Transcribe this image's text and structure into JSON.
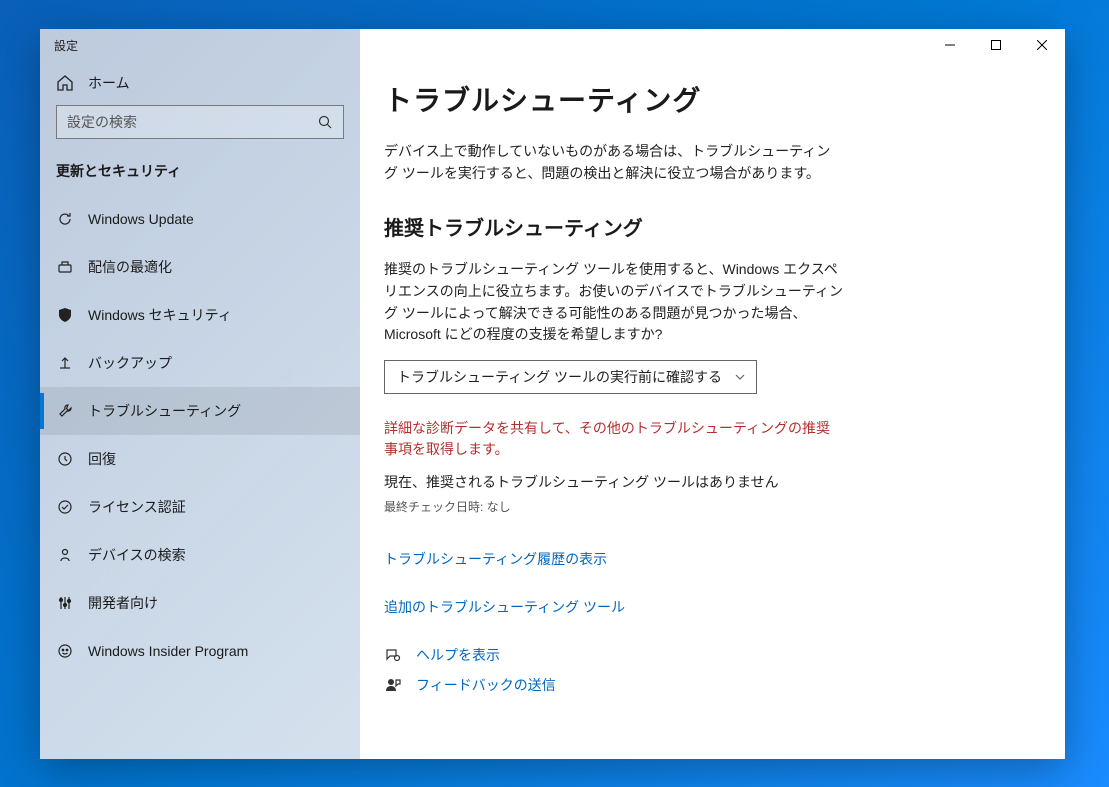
{
  "titlebar": {
    "title": "設定"
  },
  "sidebar": {
    "home_label": "ホーム",
    "search_placeholder": "設定の検索",
    "section_label": "更新とセキュリティ",
    "items": [
      {
        "label": "Windows Update"
      },
      {
        "label": "配信の最適化"
      },
      {
        "label": "Windows セキュリティ"
      },
      {
        "label": "バックアップ"
      },
      {
        "label": "トラブルシューティング"
      },
      {
        "label": "回復"
      },
      {
        "label": "ライセンス認証"
      },
      {
        "label": "デバイスの検索"
      },
      {
        "label": "開発者向け"
      },
      {
        "label": "Windows Insider Program"
      }
    ]
  },
  "main": {
    "page_title": "トラブルシューティング",
    "intro": "デバイス上で動作していないものがある場合は、トラブルシューティング ツールを実行すると、問題の検出と解決に役立つ場合があります。",
    "section_heading": "推奨トラブルシューティング",
    "section_desc": "推奨のトラブルシューティング ツールを使用すると、Windows エクスペリエンスの向上に役立ちます。お使いのデバイスでトラブルシューティング ツールによって解決できる可能性のある問題が見つかった場合、Microsoft にどの程度の支援を希望しますか?",
    "select_value": "トラブルシューティング ツールの実行前に確認する",
    "warning": "詳細な診断データを共有して、その他のトラブルシューティングの推奨事項を取得します。",
    "status": "現在、推奨されるトラブルシューティング ツールはありません",
    "last_check": "最終チェック日時: なし",
    "link_history": "トラブルシューティング履歴の表示",
    "link_additional": "追加のトラブルシューティング ツール",
    "help_label": "ヘルプを表示",
    "feedback_label": "フィードバックの送信"
  }
}
